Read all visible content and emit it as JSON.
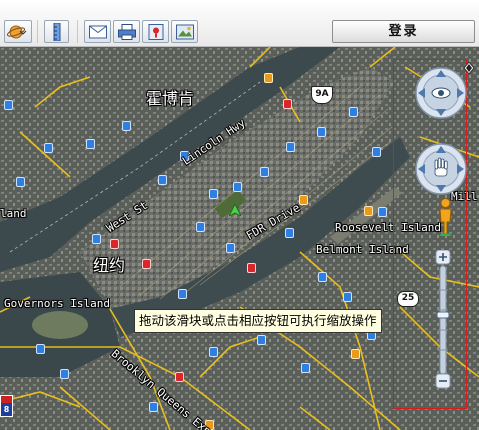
{
  "toolbar": {
    "buttons": [
      {
        "name": "planet-menu",
        "icon": "planet-icon"
      },
      {
        "name": "ruler",
        "icon": "ruler-icon"
      },
      {
        "name": "email",
        "icon": "envelope-icon"
      },
      {
        "name": "print",
        "icon": "printer-icon"
      },
      {
        "name": "placemark",
        "icon": "placemark-icon"
      },
      {
        "name": "image",
        "icon": "image-icon"
      }
    ],
    "login_label": "登录"
  },
  "map": {
    "place_labels": {
      "huoboken": "霍博肯",
      "niuyue": "纽约",
      "governors_island": "Governors Island",
      "roosevelt_island": "Roosevelt Island",
      "belmont_island": "Belmont Island",
      "fdr_drive": "FDR Drive",
      "lincoln_hwy": "Lincoln Hwy",
      "west_st": "West St",
      "brooklyn_queens_expy": "Brooklyn Queens Expy",
      "island_left": "land",
      "mill_right": "Mill"
    },
    "shields": {
      "route_9a": "9A",
      "route_25": "25",
      "interstate_8": "8"
    }
  },
  "controls": {
    "look_icon": "eye-icon",
    "move_icon": "hand-icon",
    "street_view_icon": "pegman-icon",
    "zoom_in": "+",
    "zoom_out": "−",
    "compass": "N"
  },
  "tooltip": {
    "text": "拖动该滑块或点击相应按钮可执行缩放操作"
  },
  "colors": {
    "frame": "#d61b1b",
    "road": "#f0c419",
    "water": "#3e4b4f"
  }
}
